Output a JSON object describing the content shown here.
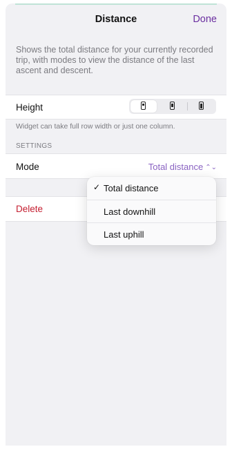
{
  "nav": {
    "title": "Distance",
    "done_label": "Done"
  },
  "description": "Shows the total distance for your currently recorded trip, with modes to view the distance of the last ascent and descent.",
  "height": {
    "label": "Height",
    "options": [
      "small-height-icon",
      "medium-height-icon",
      "large-height-icon"
    ],
    "selected_index": 0
  },
  "helper_text": "Widget can take full row width or just one column.",
  "settings": {
    "header": "SETTINGS",
    "mode": {
      "label": "Mode",
      "value": "Total distance"
    }
  },
  "delete_label": "Delete",
  "mode_menu": {
    "items": [
      {
        "label": "Total distance",
        "checked": true
      },
      {
        "label": "Last downhill",
        "checked": false
      },
      {
        "label": "Last uphill",
        "checked": false
      }
    ],
    "check_glyph": "✓"
  },
  "colors": {
    "accent": "#6b2fa0",
    "mode_value": "#8a63c2",
    "destructive": "#c41d2f"
  }
}
